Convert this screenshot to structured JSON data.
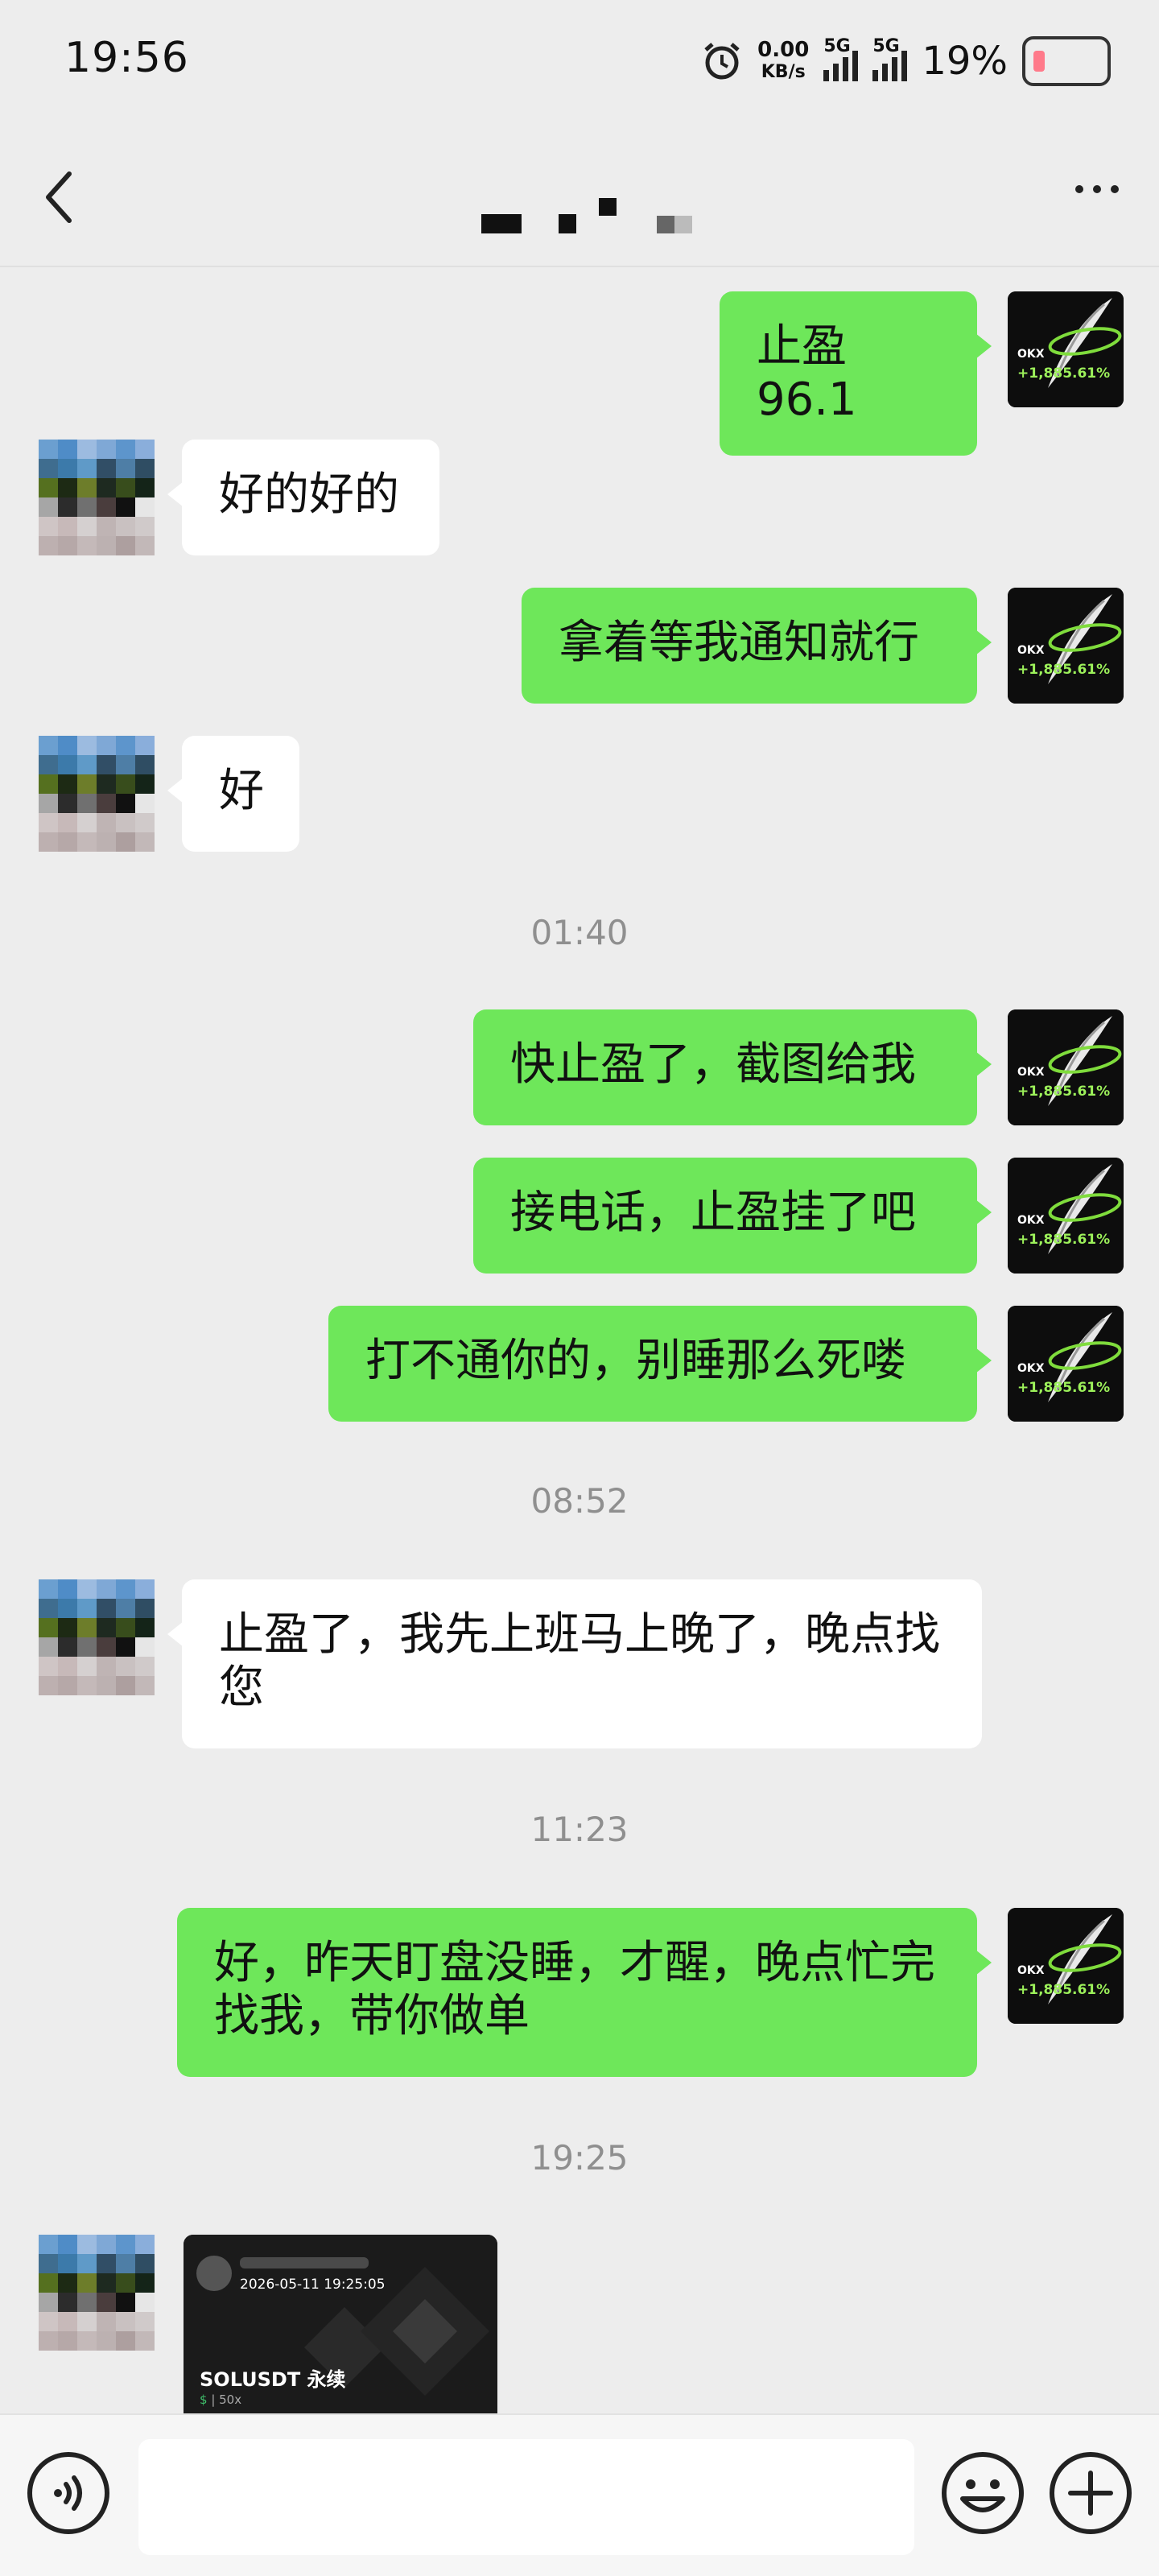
{
  "status_bar": {
    "time": "19:56",
    "net_speed_value": "0.00",
    "net_speed_unit": "KB/s",
    "sim1_label": "5G",
    "sim2_label": "5G",
    "battery_percent": "19%"
  },
  "nav": {
    "back_icon": "chevron-left-icon",
    "more_icon": "more-dots-icon"
  },
  "messages": [
    {
      "side": "me",
      "text": "止盈96.1"
    },
    {
      "side": "them",
      "text": "好的好的"
    },
    {
      "side": "me",
      "text": "拿着等我通知就行"
    },
    {
      "side": "them",
      "text": "好"
    },
    {
      "type": "time",
      "text": "01:40"
    },
    {
      "side": "me",
      "text": "快止盈了，截图给我"
    },
    {
      "side": "me",
      "text": "接电话，止盈挂了吧"
    },
    {
      "side": "me",
      "text": "打不通你的，别睡那么死喽"
    },
    {
      "type": "time",
      "text": "08:52"
    },
    {
      "side": "them",
      "text": "止盈了，我先上班马上晚了，晚点找您"
    },
    {
      "type": "time",
      "text": "11:23"
    },
    {
      "side": "me",
      "text": "好，昨天盯盘没睡，才醒，晚点忙完找我，带你做单"
    },
    {
      "type": "time",
      "text": "19:25"
    }
  ],
  "self_avatar": {
    "brand": "OKX",
    "percent": "+1,885.61%"
  },
  "shared_card": {
    "timestamp": "2026-05-11 19:25:05",
    "title": "SOLUSDT 永续",
    "leverage": "50x"
  },
  "bottom_bar": {
    "voice_icon": "voice-icon",
    "emoji_icon": "emoji-icon",
    "plus_icon": "plus-icon"
  }
}
